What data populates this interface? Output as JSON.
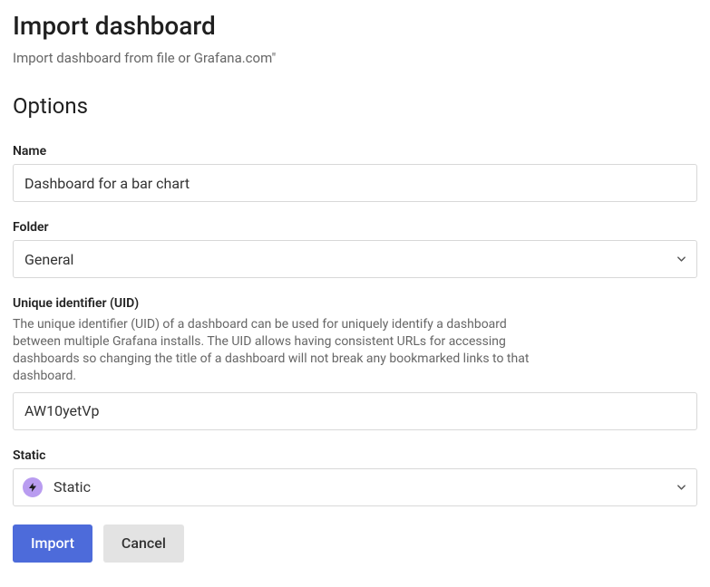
{
  "header": {
    "title": "Import dashboard",
    "subtitle": "Import dashboard from file or Grafana.com\""
  },
  "section": {
    "title": "Options"
  },
  "fields": {
    "name": {
      "label": "Name",
      "value": "Dashboard for a bar chart"
    },
    "folder": {
      "label": "Folder",
      "value": "General"
    },
    "uid": {
      "label": "Unique identifier (UID)",
      "description": "The unique identifier (UID) of a dashboard can be used for uniquely identify a dashboard between multiple Grafana installs. The UID allows having consistent URLs for accessing dashboards so changing the title of a dashboard will not break any bookmarked links to that dashboard.",
      "value": "AW10yetVp"
    },
    "static": {
      "label": "Static",
      "value": "Static"
    }
  },
  "buttons": {
    "import": "Import",
    "cancel": "Cancel"
  }
}
